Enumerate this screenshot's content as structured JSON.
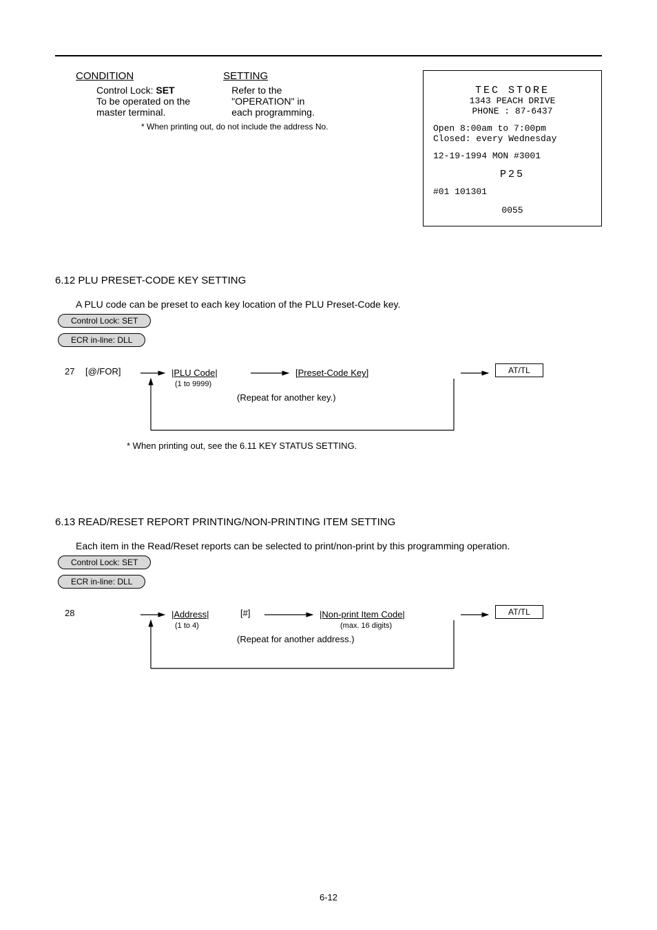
{
  "header": {
    "condition_label": "CONDITION",
    "setting_label": "SETTING",
    "cond_l1": "Control Lock:",
    "cond_l1v": "SET",
    "cond_l2": "To be operated on the",
    "cond_l3": "master terminal.",
    "set_l1": "Refer to the",
    "set_l2": "\"OPERATION\" in",
    "set_l3": "each programming.",
    "note": "* When printing out, do not include the address No."
  },
  "receipt": {
    "title": "TEC STORE",
    "addr": "1343 PEACH DRIVE",
    "phone": "PHONE : 87-6437",
    "open": "Open  8:00am to 7:00pm",
    "closed": "Closed: every Wednesday",
    "date": "12-19-1994  MON #3001",
    "p": "P25",
    "hash": "#01 101301",
    "foot": "0055"
  },
  "b1": {
    "title": "6.12 PLU PRESET-CODE KEY SETTING",
    "desc": "A PLU code can be preset to each key location of the PLU Preset-Code key.",
    "pill_lock": "Control Lock: SET",
    "pill_ecr": "ECR in-line: DLL",
    "flow": {
      "num": "27",
      "at": "[@/FOR]",
      "plu_code": "|PLU Code|",
      "plu_range": "(1 to 9999)",
      "preset": "[Preset-Code Key]",
      "key": "AT/TL",
      "repeat": "(Repeat for another key.)",
      "note": "* When printing out, see the 6.11 KEY STATUS SETTING."
    }
  },
  "b2": {
    "title": "6.13 READ/RESET REPORT PRINTING/NON-PRINTING ITEM SETTING",
    "desc": "Each item in the Read/Reset reports can be selected to print/non-print by this programming operation.",
    "pill_lock": "Control Lock: SET",
    "pill_ecr": "ECR in-line: DLL",
    "flow": {
      "num": "28",
      "label1": "|Address|",
      "range1": "(1 to 4)",
      "sharp": "[#]",
      "label2": "|Non-print Item Code|",
      "range2": "(max. 16 digits)",
      "key": "AT/TL",
      "repeat": "(Repeat for another address.)"
    }
  },
  "footer": {
    "page": "6-12"
  }
}
